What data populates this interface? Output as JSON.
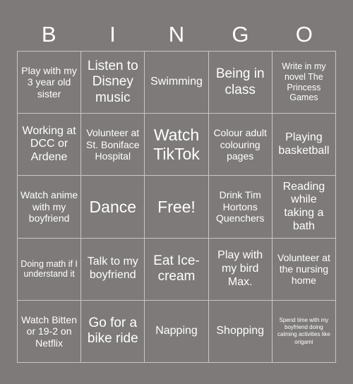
{
  "card": {
    "title_letters": [
      "B",
      "I",
      "N",
      "G",
      "O"
    ],
    "background_color": "#7d7a79",
    "text_color": "#ffffff",
    "border_color": "#c9c6c5",
    "rows": 5,
    "columns": 5
  },
  "cells": [
    {
      "text": "Play with my 3 year old sister",
      "size": "fs-sm"
    },
    {
      "text": "Listen to Disney music",
      "size": "fs-lg"
    },
    {
      "text": "Swimming",
      "size": "fs-md"
    },
    {
      "text": "Being in class",
      "size": "fs-lg"
    },
    {
      "text": "Write in my novel The Princess Games",
      "size": "fs-xs"
    },
    {
      "text": "Working at DCC or Ardene",
      "size": "fs-md"
    },
    {
      "text": "Volunteer at St. Boniface Hospital",
      "size": "fs-sm"
    },
    {
      "text": "Watch TikTok",
      "size": "fs-xl"
    },
    {
      "text": "Colour adult colouring pages",
      "size": "fs-sm"
    },
    {
      "text": "Playing basketball",
      "size": "fs-md"
    },
    {
      "text": "Watch anime with my boyfriend",
      "size": "fs-sm"
    },
    {
      "text": "Dance",
      "size": "fs-xl"
    },
    {
      "text": "Free!",
      "size": "fs-xl"
    },
    {
      "text": "Drink Tim Hortons Quenchers",
      "size": "fs-sm"
    },
    {
      "text": "Reading while taking a bath",
      "size": "fs-md"
    },
    {
      "text": "Doing math if I understand it",
      "size": "fs-xs"
    },
    {
      "text": "Talk to my boyfriend",
      "size": "fs-md"
    },
    {
      "text": "Eat Ice-cream",
      "size": "fs-lg"
    },
    {
      "text": "Play with my bird Max.",
      "size": "fs-md"
    },
    {
      "text": "Volunteer at the nursing home",
      "size": "fs-sm"
    },
    {
      "text": "Watch Bitten or 19-2 on Netflix",
      "size": "fs-sm"
    },
    {
      "text": "Go for a bike ride",
      "size": "fs-lg"
    },
    {
      "text": "Napping",
      "size": "fs-md"
    },
    {
      "text": "Shopping",
      "size": "fs-md"
    },
    {
      "text": "Spend time with my boyfriend doing calming activities like origami",
      "size": "fs-xxs"
    }
  ]
}
